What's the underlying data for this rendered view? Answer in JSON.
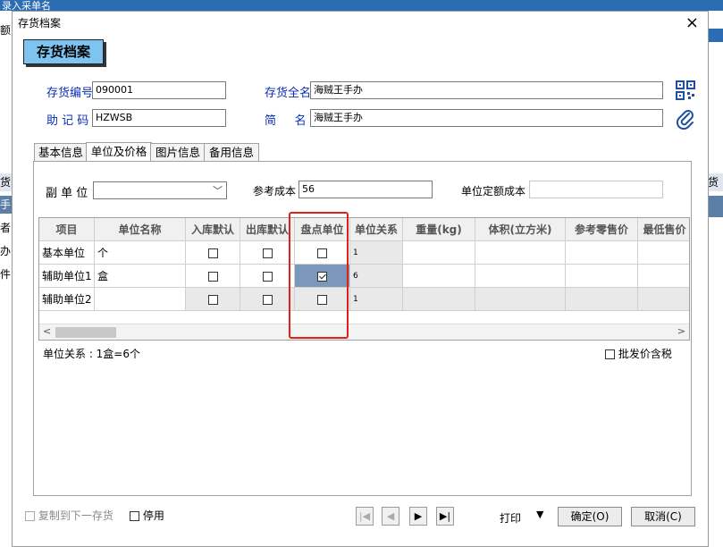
{
  "background": {
    "top_text": "录入采单名",
    "left_fragments": [
      "额",
      "货全",
      "手办",
      "者手",
      "办",
      "件套"
    ],
    "right_fragments": [
      "货辅"
    ]
  },
  "dialog": {
    "title": "存货档案",
    "close_glyph": "×",
    "banner": "存货档案"
  },
  "header_fields": {
    "code_label": "存货编号",
    "code_value": "090001",
    "fullname_label": "存货全名",
    "fullname_value": "海贼王手办",
    "mnemonic_label": "助 记 码",
    "mnemonic_value": "HZWSB",
    "shortname_label": "简     名",
    "shortname_value": "海贼王手办"
  },
  "tabs": [
    "基本信息",
    "单位及价格",
    "图片信息",
    "备用信息"
  ],
  "unit_settings": {
    "sub_unit_label": "副 单 位",
    "sub_unit_value": "",
    "ref_cost_label": "参考成本",
    "ref_cost_value": "56",
    "unit_quota_cost_label": "单位定额成本",
    "unit_quota_cost_value": ""
  },
  "grid": {
    "columns": [
      "项目",
      "单位名称",
      "入库默认",
      "出库默认",
      "盘点单位",
      "单位关系",
      "重量(kg)",
      "体积(立方米)",
      "参考零售价",
      "最低售价"
    ],
    "rows": [
      {
        "item": "基本单位",
        "unit_name": "个",
        "in_default": false,
        "out_default": false,
        "inventory_unit": false,
        "relation": "1"
      },
      {
        "item": "辅助单位1",
        "unit_name": "盒",
        "in_default": false,
        "out_default": false,
        "inventory_unit": true,
        "relation": "6"
      },
      {
        "item": "辅助单位2",
        "unit_name": "",
        "in_default": false,
        "out_default": false,
        "inventory_unit": false,
        "relation": "1"
      }
    ]
  },
  "relation_text": "单位关系 : 1盒=6个",
  "wholesale_tax_label": "批发价含税",
  "footer": {
    "copy_label": "复制到下一存货",
    "disable_label": "停用",
    "print_label": "打印",
    "ok_label": "确定(O)",
    "cancel_label": "取消(C)"
  },
  "colors": {
    "banner_bg": "#7ec4f0",
    "label_blue": "#0a2fb5",
    "highlight_box": "#e0201a",
    "selected_cell": "#7b97b9"
  }
}
